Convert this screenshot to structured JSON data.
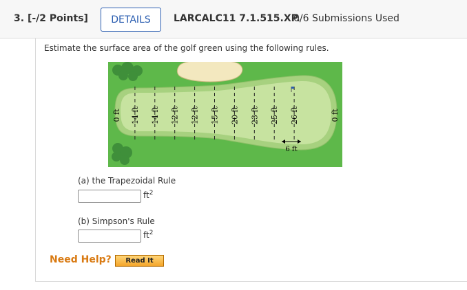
{
  "question": {
    "number": "3.",
    "points": "[-/2 Points]",
    "details_label": "DETAILS",
    "code": "LARCALC11 7.1.515.XP.",
    "submissions": "0/6 Submissions Used"
  },
  "prompt": "Estimate the surface area of the golf green using the following rules.",
  "figure": {
    "widths": [
      "0 ft",
      "14 ft",
      "14 ft",
      "12 ft",
      "12 ft",
      "15 ft",
      "20 ft",
      "23 ft",
      "25 ft",
      "26 ft",
      "0 ft"
    ],
    "spacing_label": "6 ft"
  },
  "parts": [
    {
      "label": "(a) the Trapezoidal Rule",
      "value": "",
      "unit": "ft",
      "unit_exp": "2"
    },
    {
      "label": "(b) Simpson's Rule",
      "value": "",
      "unit": "ft",
      "unit_exp": "2"
    }
  ],
  "help": {
    "label": "Need Help?",
    "read_it": "Read It"
  },
  "colors": {
    "link_blue": "#2a5db0",
    "grass": "#5eb84a",
    "green": "#c7e3a0",
    "sand": "#f3e8bf",
    "help_orange": "#d97a12"
  }
}
